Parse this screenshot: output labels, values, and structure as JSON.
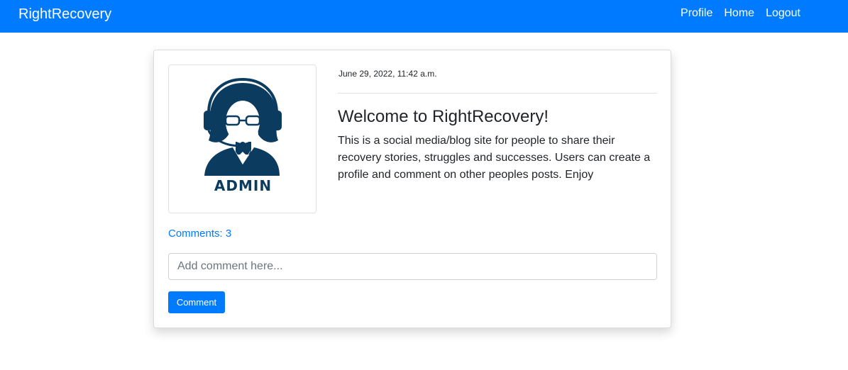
{
  "app": {
    "brand": "RightRecovery",
    "accent_color": "#007bff"
  },
  "nav": {
    "items": [
      {
        "label": "Profile"
      },
      {
        "label": "Home"
      },
      {
        "label": "Logout"
      }
    ]
  },
  "post": {
    "avatar": {
      "icon": "admin-headset-avatar-icon",
      "label": "ADMIN",
      "color": "#0b3b5e"
    },
    "date": "June 29, 2022, 11:42 a.m.",
    "title": "Welcome to RightRecovery!",
    "body": "This is a social media/blog site for people to share their recovery stories, struggles and successes. Users can create a profile and comment on other peoples posts. Enjoy",
    "comments_label": "Comments: 3"
  },
  "comment_form": {
    "placeholder": "Add comment here...",
    "value": "",
    "submit_label": "Comment"
  }
}
